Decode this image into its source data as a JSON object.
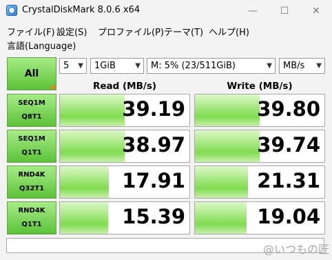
{
  "window": {
    "title": "CrystalDiskMark 8.0.6 x64",
    "minimize": "—",
    "maximize": "☐",
    "close": "✕"
  },
  "menu": {
    "file": "ファイル(F)",
    "settings": "設定(S)",
    "profile": "プロファイル(P)",
    "theme": "テーマ(T)",
    "help": "ヘルプ(H)",
    "language": "言語(Language)"
  },
  "controls": {
    "all_label": "All",
    "count": "5",
    "size": "1GiB",
    "drive": "M: 5% (23/511GiB)",
    "unit": "MB/s"
  },
  "headers": {
    "read": "Read (MB/s)",
    "write": "Write (MB/s)"
  },
  "rows": [
    {
      "line1": "SEQ1M",
      "line2": "Q8T1",
      "read": "39.19",
      "write": "39.80",
      "read_fill": 0.5,
      "write_fill": 0.5
    },
    {
      "line1": "SEQ1M",
      "line2": "Q1T1",
      "read": "38.97",
      "write": "39.74",
      "read_fill": 0.5,
      "write_fill": 0.5
    },
    {
      "line1": "RND4K",
      "line2": "Q32T1",
      "read": "17.91",
      "write": "21.31",
      "read_fill": 0.38,
      "write_fill": 0.41
    },
    {
      "line1": "RND4K",
      "line2": "Q1T1",
      "read": "15.39",
      "write": "19.04",
      "read_fill": 0.37,
      "write_fill": 0.4
    }
  ],
  "comment": "",
  "watermark": "@いつもの匠",
  "colors": {
    "accent_green": "#5cc238",
    "orange_marker": "#f07c13"
  }
}
